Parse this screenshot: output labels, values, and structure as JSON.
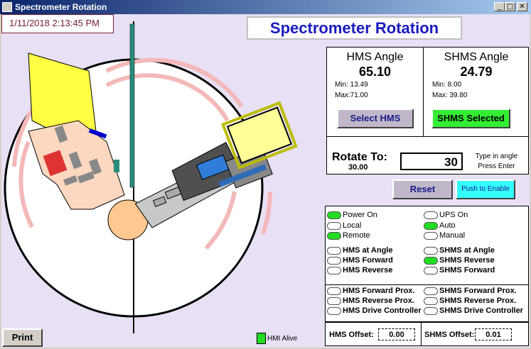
{
  "window": {
    "title": "Spectrometer Rotation"
  },
  "datetime": "1/11/2018 2:13:45 PM",
  "main_title": "Spectrometer Rotation",
  "hms": {
    "title": "HMS Angle",
    "angle": "65.10",
    "min": "Min:  13.49",
    "max": "Max:71.00",
    "button": "Select HMS"
  },
  "shms": {
    "title": "SHMS Angle",
    "angle": "24.79",
    "min": "Min:  8.00",
    "max": "Max: 39.80",
    "button": "SHMS Selected"
  },
  "rotate": {
    "label": "Rotate To:",
    "current": "30.00",
    "input": "30",
    "hint1": "Type in angle",
    "hint2": "Press Enter"
  },
  "reset_label": "Reset",
  "enable_label": "Push to Enable",
  "status_left": [
    {
      "label": "Power On",
      "on": true,
      "bold": false
    },
    {
      "label": "Local",
      "on": false,
      "bold": false
    },
    {
      "label": "Remote",
      "on": true,
      "bold": false
    },
    {
      "label": "HMS at Angle",
      "on": false,
      "bold": true
    },
    {
      "label": "HMS Forward",
      "on": false,
      "bold": true
    },
    {
      "label": "HMS Reverse",
      "on": false,
      "bold": true
    },
    {
      "label": "HMS Forward Prox.",
      "on": false,
      "bold": true
    },
    {
      "label": "HMS Reverse Prox.",
      "on": false,
      "bold": true
    },
    {
      "label": "HMS Drive Controller",
      "on": false,
      "bold": true
    }
  ],
  "status_right": [
    {
      "label": "UPS On",
      "on": false,
      "bold": false
    },
    {
      "label": "Auto",
      "on": true,
      "bold": false
    },
    {
      "label": "Manual",
      "on": false,
      "bold": false
    },
    {
      "label": "SHMS at Angle",
      "on": false,
      "bold": true
    },
    {
      "label": "SHMS Reverse",
      "on": true,
      "bold": true
    },
    {
      "label": "SHMS Forward",
      "on": false,
      "bold": true
    },
    {
      "label": "SHMS Forward Prox.",
      "on": false,
      "bold": true
    },
    {
      "label": "SHMS Reverse Prox.",
      "on": false,
      "bold": true
    },
    {
      "label": "SHMS Drive Controller",
      "on": false,
      "bold": true
    }
  ],
  "hms_offset": {
    "label": "HMS Offset:",
    "value": "0.00"
  },
  "shms_offset": {
    "label": "SHMS Offset:",
    "value": "0.01"
  },
  "print_label": "Print",
  "hmi_alive": "HMI Alive",
  "colors": {
    "title_blue": "#1a1ac0",
    "lamp_on": "#22dd22",
    "enable_cyan": "#33ffff",
    "selected_green": "#33ee33"
  }
}
